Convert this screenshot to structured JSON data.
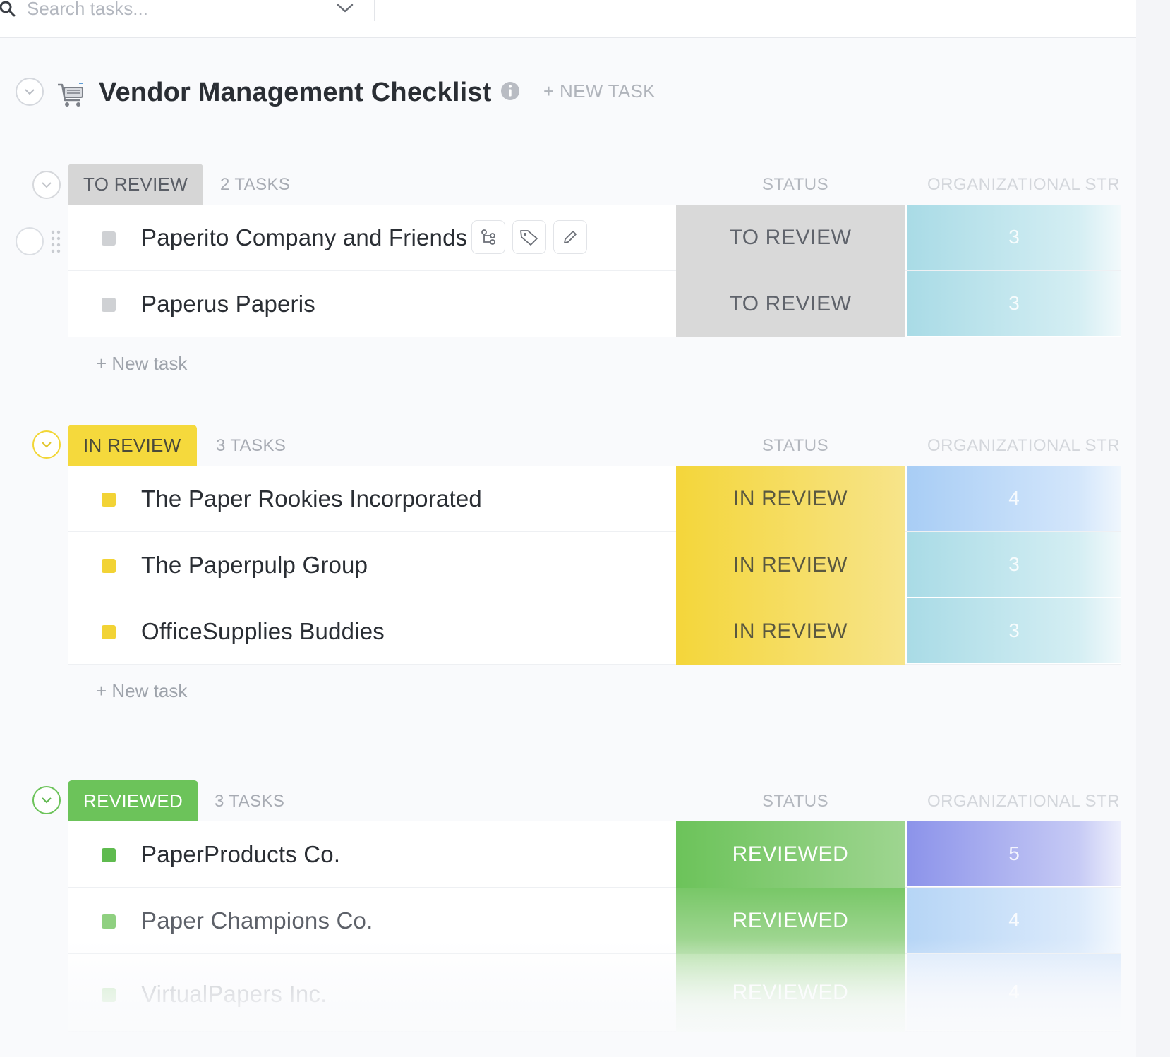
{
  "search": {
    "placeholder": "Search tasks..."
  },
  "list": {
    "title": "Vendor Management Checklist",
    "new_task_label": "+ NEW TASK"
  },
  "columns": {
    "status": "STATUS",
    "org": "ORGANIZATIONAL STRUCTURE"
  },
  "groups": [
    {
      "label": "TO REVIEW",
      "count": "2 TASKS",
      "color": "#d6d6d6",
      "text_color": "#5a5e66",
      "new_task": "+ New task",
      "tasks": [
        {
          "name": "Paperito Company and Friends",
          "status": "TO REVIEW",
          "org": "3"
        },
        {
          "name": "Paperus Paperis",
          "status": "TO REVIEW",
          "org": "3"
        }
      ]
    },
    {
      "label": "IN REVIEW",
      "count": "3 TASKS",
      "color": "#f5d93c",
      "text_color": "#4a4a3a",
      "new_task": "+ New task",
      "tasks": [
        {
          "name": "The Paper Rookies Incorporated",
          "status": "IN REVIEW",
          "org": "4"
        },
        {
          "name": "The Paperpulp Group",
          "status": "IN REVIEW",
          "org": "3"
        },
        {
          "name": "OfficeSupplies Buddies",
          "status": "IN REVIEW",
          "org": "3"
        }
      ]
    },
    {
      "label": "REVIEWED",
      "count": "3 TASKS",
      "color": "#6cc35a",
      "text_color": "#ffffff",
      "tasks": [
        {
          "name": "PaperProducts Co.",
          "status": "REVIEWED",
          "org": "5"
        },
        {
          "name": "Paper Champions Co.",
          "status": "REVIEWED",
          "org": "4"
        },
        {
          "name": "VirtualPapers Inc.",
          "status": "REVIEWED",
          "org": "4"
        }
      ]
    }
  ]
}
